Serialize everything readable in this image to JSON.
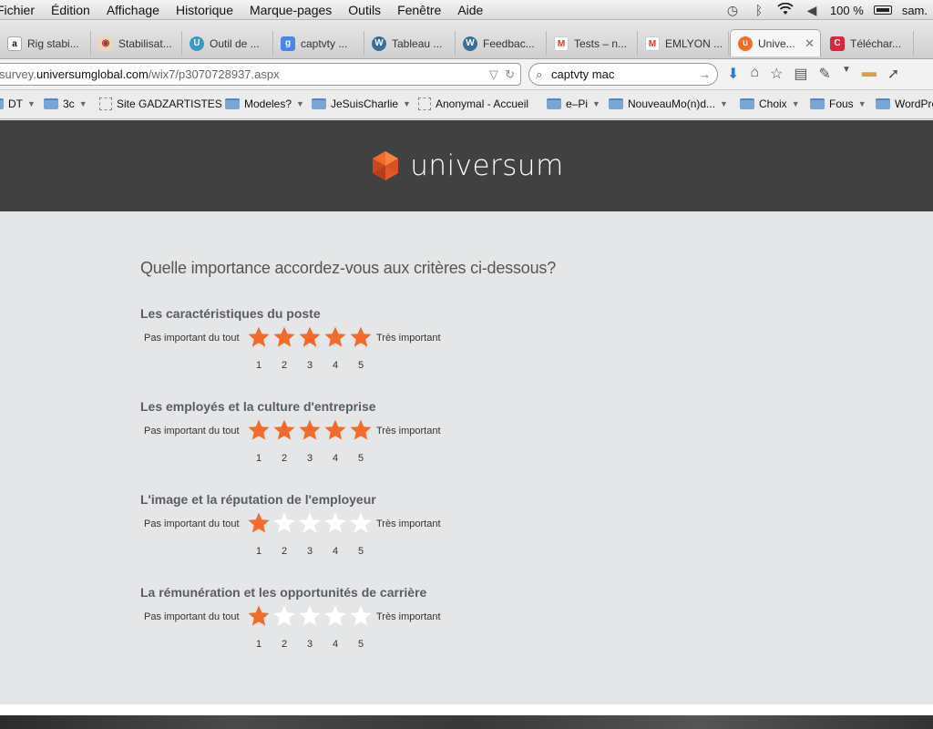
{
  "menubar": {
    "items": [
      "Fichier",
      "Édition",
      "Affichage",
      "Historique",
      "Marque-pages",
      "Outils",
      "Fenêtre",
      "Aide"
    ],
    "battery": "100 %",
    "user": "sam."
  },
  "tabs": [
    {
      "label": "Rig stabi...",
      "icon": "amazon-icon"
    },
    {
      "label": "Stabilisat...",
      "icon": "site-icon"
    },
    {
      "label": "Outil de ...",
      "icon": "tool-icon"
    },
    {
      "label": "captvty ...",
      "icon": "google-icon"
    },
    {
      "label": "Tableau ...",
      "icon": "wordpress-icon"
    },
    {
      "label": "Feedbac...",
      "icon": "wordpress-icon"
    },
    {
      "label": "Tests – n...",
      "icon": "gmail-icon"
    },
    {
      "label": "EMLYON ...",
      "icon": "gmail-icon"
    },
    {
      "label": "Unive...",
      "icon": "universum-icon",
      "active": true
    },
    {
      "label": "Téléchar...",
      "icon": "download-icon"
    }
  ],
  "navbar": {
    "url_prefix": "survey.",
    "url_host": "universumglobal.com",
    "url_path": "/wix7/p3070728937.aspx",
    "search_value": "captvty mac"
  },
  "bookmarks": [
    {
      "label": "DT",
      "type": "folder"
    },
    {
      "label": "3c",
      "type": "folder"
    },
    {
      "label": "Site GADZARTISTES",
      "type": "page"
    },
    {
      "label": "Modeles?",
      "type": "folder"
    },
    {
      "label": "JeSuisCharlie",
      "type": "folder"
    },
    {
      "label": "Anonymal - Accueil",
      "type": "page"
    },
    {
      "label": "e–Pi",
      "type": "folder"
    },
    {
      "label": "NouveauMo(n)d...",
      "type": "folder"
    },
    {
      "label": "Choix",
      "type": "folder"
    },
    {
      "label": "Fous",
      "type": "folder"
    },
    {
      "label": "WordPre...",
      "type": "folder"
    }
  ],
  "site": {
    "brand": "universum",
    "accent_color": "#f26b2d",
    "question": "Quelle importance accordez-vous aux critères ci-dessous?",
    "scale_min_label": "Pas important du tout",
    "scale_max_label": "Très important",
    "scale_numbers": [
      "1",
      "2",
      "3",
      "4",
      "5"
    ],
    "criteria": [
      {
        "title": "Les caractéristiques du poste",
        "rating": 5
      },
      {
        "title": "Les employés et la culture d'entreprise",
        "rating": 5
      },
      {
        "title": "L'image et la réputation de l'employeur",
        "rating": 1
      },
      {
        "title": "La rémunération et les opportunités de carrière",
        "rating": 1
      }
    ]
  }
}
